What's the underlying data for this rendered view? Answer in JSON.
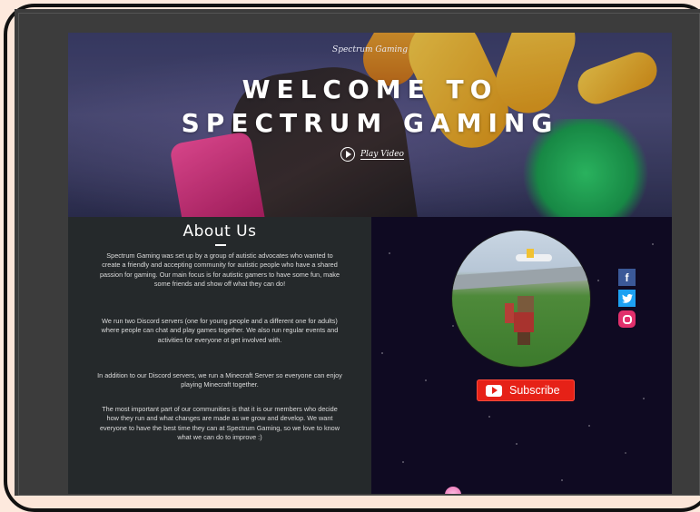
{
  "hero": {
    "brand": "Spectrum Gaming",
    "title_line1": "WELCOME TO",
    "title_line2": "SPECTRUM GAMING",
    "play_label": "Play Video"
  },
  "about": {
    "heading": "About Us",
    "paragraphs": [
      "Spectrum Gaming was set up by a group of autistic advocates who wanted to create a friendly and accepting community for autistic people who have a shared passion for gaming. Our main focus is for autistic gamers to have some fun, make some friends and show off what they can do!",
      "We run two Discord servers (one for young people and a different one for adults) where people can chat and play games together. We also run regular events and activities for everyone ot get involved with.",
      "In addition to our Discord servers, we run a Minecraft Server so everyone can enjoy playing Minecraft together.",
      "The most important part of our communities is that it is our members who decide how they run and what changes are made as we grow and develop. We want everyone to have the best time they can at Spectrum Gaming, so we love to know what we can do to improve :)"
    ]
  },
  "social": {
    "facebook_glyph": "f",
    "icons": [
      "facebook-icon",
      "twitter-icon",
      "instagram-icon"
    ]
  },
  "youtube": {
    "subscribe_label": "Subscribe"
  },
  "colors": {
    "about_bg": "#25292b",
    "space_bg": "#0f0a22",
    "subscribe_red": "#e62117",
    "facebook": "#3b5998",
    "twitter": "#1da1f2",
    "instagram": "#e1306c"
  }
}
